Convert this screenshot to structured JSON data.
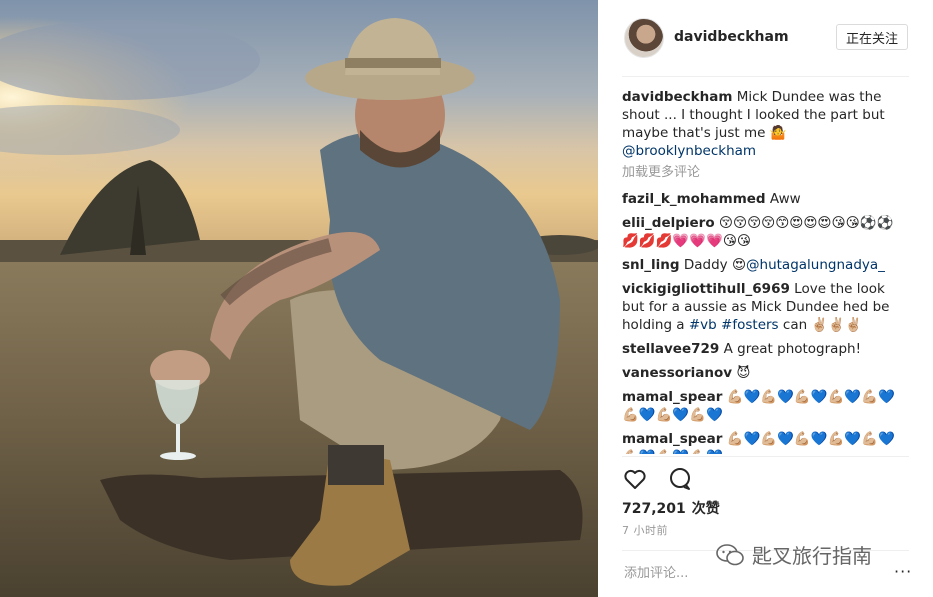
{
  "header": {
    "username": "davidbeckham",
    "follow_label": "正在关注"
  },
  "caption": {
    "username": "davidbeckham",
    "text": "Mick Dundee was the shout ... I thought I looked the part but maybe that's just me 🤷",
    "mention": "@brooklynbeckham"
  },
  "load_more_label": "加载更多评论",
  "comments": [
    {
      "user": "fazil_k_mohammed",
      "text": "Aww"
    },
    {
      "user": "elii_delpiero",
      "text": "😚😚😚😚😙😍😍😍😘😘⚽⚽💋💋💋💗💗💗😘😘"
    },
    {
      "user": "snl_ling",
      "text": "Daddy 😍",
      "mention": "@hutagalungnadya_"
    },
    {
      "user": "vickigigliottihull_6969",
      "text": "Love the look but for a aussie as Mick Dundee hed be holding a",
      "tag1": "#vb",
      "tag2": "#fosters",
      "tail": "can ✌🏼✌🏼✌🏼"
    },
    {
      "user": "stellavee729",
      "text": "A great photograph!"
    },
    {
      "user": "vanessorianov",
      "text": "😈"
    },
    {
      "user": "mamal_spear",
      "text": "💪🏼💙💪🏼💙💪🏼💙💪🏼💙💪🏼💙💪🏼💙💪🏼💙💪🏼💙"
    },
    {
      "user": "mamal_spear",
      "text": "💪🏼💙💪🏼💙💪🏼💙💪🏼💙💪🏼💙💪🏼💙💪🏼💙💪🏼💙"
    }
  ],
  "actions": {
    "like_icon": "heart-icon",
    "comment_icon": "comment-icon"
  },
  "likes": {
    "count": "727,201",
    "label": "次赞"
  },
  "time_ago": "7 小时前",
  "add_comment_placeholder": "添加评论...",
  "more_options": "···",
  "watermark": "匙叉旅行指南",
  "colors": {
    "link": "#003569",
    "muted": "#999999",
    "border": "#dbdbdb"
  }
}
